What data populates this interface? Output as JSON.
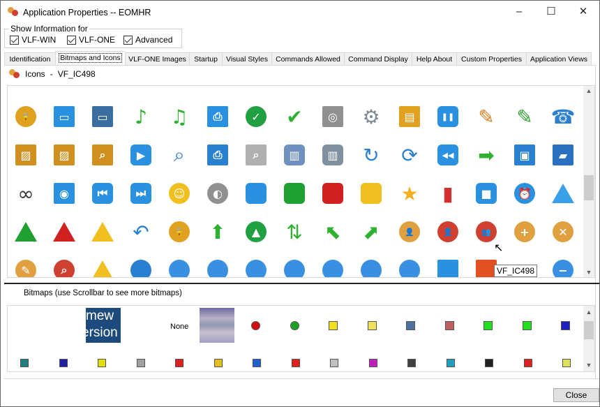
{
  "window": {
    "title": "Application Properties -- EOMHR",
    "minimize": "–",
    "maximize": "☐",
    "close": "✕"
  },
  "show_info": {
    "legend": "Show Information for",
    "options": [
      {
        "label": "VLF-WIN",
        "checked": true
      },
      {
        "label": "VLF-ONE",
        "checked": true
      },
      {
        "label": "Advanced",
        "checked": true
      }
    ]
  },
  "tabs": [
    "Identification",
    "Bitmaps and Icons",
    "VLF-ONE Images",
    "Startup",
    "Visual Styles",
    "Commands Allowed",
    "Command Display",
    "Help About",
    "Custom Properties",
    "Application Views"
  ],
  "active_tab": "Bitmaps and Icons",
  "icons_header": {
    "label": "Icons",
    "separator": "-",
    "selected": "VF_IC498"
  },
  "icons": [
    [
      {
        "n": "lock",
        "s": "circle",
        "c": "#e0a020",
        "g": "🔒"
      },
      {
        "n": "monitor",
        "s": "square",
        "c": "#2a90e0",
        "g": "▭"
      },
      {
        "n": "monitor-dark",
        "s": "square",
        "c": "#3a6ea0",
        "g": "▭"
      },
      {
        "n": "music-note",
        "s": "glyph",
        "c": "#30b030",
        "g": "♪"
      },
      {
        "n": "music-notes",
        "s": "glyph",
        "c": "#30b030",
        "g": "♫"
      },
      {
        "n": "computers",
        "s": "square",
        "c": "#2a90e0",
        "g": "⎙"
      },
      {
        "n": "check-circle",
        "s": "circle",
        "c": "#20a040",
        "g": "✓"
      },
      {
        "n": "check-mark",
        "s": "glyph",
        "c": "#30b030",
        "g": "✔"
      },
      {
        "n": "safe",
        "s": "square",
        "c": "#909090",
        "g": "◎"
      },
      {
        "n": "gears",
        "s": "glyph",
        "c": "#808890",
        "g": "⚙"
      },
      {
        "n": "clipboard",
        "s": "square",
        "c": "#e0a020",
        "g": "▤"
      },
      {
        "n": "pause",
        "s": "rounded",
        "c": "#2a90e0",
        "g": "❚❚"
      },
      {
        "n": "pencil-orange",
        "s": "glyph",
        "c": "#e08020",
        "g": "✎"
      },
      {
        "n": "pencil-green",
        "s": "glyph",
        "c": "#30a030",
        "g": "✎"
      },
      {
        "n": "telephone",
        "s": "glyph",
        "c": "#2a80d0",
        "g": "☎"
      }
    ],
    [
      {
        "n": "picture",
        "s": "square",
        "c": "#d09020",
        "g": "▨"
      },
      {
        "n": "picture-tilted",
        "s": "square",
        "c": "#d09020",
        "g": "▨"
      },
      {
        "n": "picture-search",
        "s": "square",
        "c": "#d09020",
        "g": "⌕"
      },
      {
        "n": "play",
        "s": "rounded",
        "c": "#2a90e0",
        "g": "▶"
      },
      {
        "n": "magnifier",
        "s": "glyph",
        "c": "#3080d0",
        "g": "⌕"
      },
      {
        "n": "printer",
        "s": "square",
        "c": "#2a80d0",
        "g": "⎙"
      },
      {
        "n": "document-search",
        "s": "square",
        "c": "#b0b0b0",
        "g": "⌕"
      },
      {
        "n": "recycle-bin",
        "s": "rounded",
        "c": "#7090c0",
        "g": "▥"
      },
      {
        "n": "recycle-bin-full",
        "s": "rounded",
        "c": "#8090a0",
        "g": "▥"
      },
      {
        "n": "redo",
        "s": "glyph",
        "c": "#2a80d0",
        "g": "↻"
      },
      {
        "n": "refresh",
        "s": "glyph",
        "c": "#2a80d0",
        "g": "⟳"
      },
      {
        "n": "rewind",
        "s": "rounded",
        "c": "#2a90e0",
        "g": "◀◀"
      },
      {
        "n": "arrow-right",
        "s": "glyph",
        "c": "#30b030",
        "g": "➡"
      },
      {
        "n": "floppy-disk",
        "s": "square",
        "c": "#2a80d0",
        "g": "▣"
      },
      {
        "n": "scanner",
        "s": "square",
        "c": "#2a70c0",
        "g": "▰"
      }
    ],
    [
      {
        "n": "binoculars",
        "s": "glyph",
        "c": "#333333",
        "g": "∞"
      },
      {
        "n": "monitor-cd",
        "s": "square",
        "c": "#2a90e0",
        "g": "◉"
      },
      {
        "n": "skip-back",
        "s": "rounded",
        "c": "#2a90e0",
        "g": "⏮"
      },
      {
        "n": "skip-forward",
        "s": "rounded",
        "c": "#2a90e0",
        "g": "⏭"
      },
      {
        "n": "smiley",
        "s": "circle",
        "c": "#f0c020",
        "g": "☺"
      },
      {
        "n": "speaker",
        "s": "circle",
        "c": "#909090",
        "g": "◐"
      },
      {
        "n": "blue-button",
        "s": "rounded",
        "c": "#2a90e0",
        "g": ""
      },
      {
        "n": "green-button",
        "s": "rounded",
        "c": "#20a030",
        "g": ""
      },
      {
        "n": "red-button",
        "s": "rounded",
        "c": "#d02020",
        "g": ""
      },
      {
        "n": "yellow-button",
        "s": "rounded",
        "c": "#f0c020",
        "g": ""
      },
      {
        "n": "star",
        "s": "glyph",
        "c": "#f0b020",
        "g": "★"
      },
      {
        "n": "bar-chart",
        "s": "glyph",
        "c": "#d03030",
        "g": "▮"
      },
      {
        "n": "stop",
        "s": "rounded",
        "c": "#2a90e0",
        "g": "■"
      },
      {
        "n": "alarm-clock",
        "s": "circle",
        "c": "#2a90e0",
        "g": "⏰"
      },
      {
        "n": "triangle-blue",
        "s": "tri",
        "c": "#3aa0e8",
        "g": ""
      }
    ],
    [
      {
        "n": "triangle-green",
        "s": "tri",
        "c": "#20a030",
        "g": ""
      },
      {
        "n": "triangle-red",
        "s": "tri",
        "c": "#d02020",
        "g": ""
      },
      {
        "n": "triangle-yellow",
        "s": "tri",
        "c": "#f0c020",
        "g": ""
      },
      {
        "n": "undo",
        "s": "glyph",
        "c": "#2a80d0",
        "g": "↶"
      },
      {
        "n": "unlock",
        "s": "circle",
        "c": "#e0a020",
        "g": "🔓"
      },
      {
        "n": "arrow-up",
        "s": "glyph",
        "c": "#30b030",
        "g": "⬆"
      },
      {
        "n": "up-circle",
        "s": "circle",
        "c": "#20a040",
        "g": "▲"
      },
      {
        "n": "arrows-up-down",
        "s": "glyph",
        "c": "#30b030",
        "g": "⇅"
      },
      {
        "n": "arrow-up-left",
        "s": "glyph",
        "c": "#30b030",
        "g": "⬉"
      },
      {
        "n": "arrow-up-right",
        "s": "glyph",
        "c": "#30b030",
        "g": "⬈"
      },
      {
        "n": "user",
        "s": "circle",
        "c": "#e0a040",
        "g": "👤"
      },
      {
        "n": "user-red",
        "s": "circle",
        "c": "#d04030",
        "g": "👤"
      },
      {
        "n": "users",
        "s": "circle",
        "c": "#d04030",
        "g": "👥"
      },
      {
        "n": "user-add",
        "s": "circle",
        "c": "#e0a040",
        "g": "+"
      },
      {
        "n": "user-delete",
        "s": "circle",
        "c": "#e0a040",
        "g": "✕"
      }
    ],
    [
      {
        "n": "user-edit",
        "s": "circle",
        "c": "#e0a040",
        "g": "✎"
      },
      {
        "n": "user-search",
        "s": "circle",
        "c": "#d04030",
        "g": "⌕"
      },
      {
        "n": "warning",
        "s": "tri",
        "c": "#f0c020",
        "g": ""
      },
      {
        "n": "globe",
        "s": "circle",
        "c": "#2a80d0",
        "g": ""
      },
      {
        "n": "globe-small",
        "s": "circle",
        "c": "#3a90e0",
        "g": ""
      },
      {
        "n": "globe-arrow",
        "s": "circle",
        "c": "#3a90e0",
        "g": ""
      },
      {
        "n": "globe-music",
        "s": "circle",
        "c": "#3a90e0",
        "g": ""
      },
      {
        "n": "globe-note",
        "s": "circle",
        "c": "#3a90e0",
        "g": ""
      },
      {
        "n": "globe-search",
        "s": "circle",
        "c": "#3a90e0",
        "g": ""
      },
      {
        "n": "globe-zoom",
        "s": "circle",
        "c": "#3a90e0",
        "g": ""
      },
      {
        "n": "globe-up",
        "s": "circle",
        "c": "#3a90e0",
        "g": ""
      },
      {
        "n": "window",
        "s": "square",
        "c": "#2a90e0",
        "g": ""
      },
      {
        "n": "windows-logo",
        "s": "square",
        "c": "#e05020",
        "g": ""
      },
      {
        "n": "blank",
        "s": "none",
        "c": "#ffffff",
        "g": ""
      },
      {
        "n": "zoom-out",
        "s": "circle",
        "c": "#3a90e0",
        "g": "−"
      }
    ]
  ],
  "tooltip": "VF_IC498",
  "bitmaps": {
    "label": "Bitmaps (use Scrollbar to see more bitmaps)",
    "banner_text": [
      "mew",
      "ersion"
    ],
    "none_label": "None",
    "row1": [
      {
        "n": "red-ball",
        "c": "#d01010"
      },
      {
        "n": "green-ball",
        "c": "#20a020"
      },
      {
        "n": "upload",
        "c": "#f0e020"
      },
      {
        "n": "database-sync",
        "c": "#f0e060"
      },
      {
        "n": "house",
        "c": "#5070a0"
      },
      {
        "n": "lifebuoy",
        "c": "#c06060"
      },
      {
        "n": "person-green",
        "c": "#20e020"
      },
      {
        "n": "plug-green",
        "c": "#20e020"
      },
      {
        "n": "flag-blue",
        "c": "#2020c0"
      }
    ],
    "row2": [
      {
        "n": "calculator",
        "c": "#208080"
      },
      {
        "n": "word-doc",
        "c": "#2020a0"
      },
      {
        "n": "traffic-light",
        "c": "#e0e000"
      },
      {
        "n": "tape-drive",
        "c": "#a0a0a0"
      },
      {
        "n": "windows-bars",
        "c": "#e02020"
      },
      {
        "n": "coins",
        "c": "#e0c020"
      },
      {
        "n": "ie-doc",
        "c": "#2060d0"
      },
      {
        "n": "workstation",
        "c": "#e02020"
      },
      {
        "n": "printer",
        "c": "#c0c0c0"
      },
      {
        "n": "book",
        "c": "#c020c0"
      },
      {
        "n": "people",
        "c": "#404040"
      },
      {
        "n": "network",
        "c": "#20a0c0"
      },
      {
        "n": "person",
        "c": "#202020"
      },
      {
        "n": "flag-red",
        "c": "#e02020"
      },
      {
        "n": "sparkle-jar",
        "c": "#e0e060"
      }
    ]
  },
  "close_button": "Close"
}
